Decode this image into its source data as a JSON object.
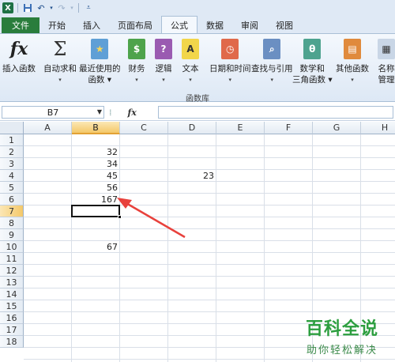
{
  "quick_access": {
    "icons": [
      "excel-icon",
      "save-icon",
      "undo-icon",
      "redo-icon",
      "customize-icon"
    ]
  },
  "tabs": [
    {
      "label": "文件",
      "kind": "file"
    },
    {
      "label": "开始"
    },
    {
      "label": "插入"
    },
    {
      "label": "页面布局"
    },
    {
      "label": "公式",
      "active": true
    },
    {
      "label": "数据"
    },
    {
      "label": "审阅"
    },
    {
      "label": "视图"
    }
  ],
  "ribbon": {
    "group_label": "函数库",
    "buttons": [
      {
        "line1": "插入函数",
        "line2": "",
        "icon": "insert-function-icon"
      },
      {
        "line1": "自动求和",
        "line2": "▾",
        "icon": "autosum-icon"
      },
      {
        "line1": "最近使用的",
        "line2": "函数 ▾",
        "icon": "recent-functions-icon"
      },
      {
        "line1": "财务",
        "line2": "▾",
        "icon": "financial-icon"
      },
      {
        "line1": "逻辑",
        "line2": "▾",
        "icon": "logical-icon"
      },
      {
        "line1": "文本",
        "line2": "▾",
        "icon": "text-icon"
      },
      {
        "line1": "日期和时间",
        "line2": "▾",
        "icon": "date-time-icon"
      },
      {
        "line1": "查找与引用",
        "line2": "▾",
        "icon": "lookup-reference-icon"
      },
      {
        "line1": "数学和",
        "line2": "三角函数 ▾",
        "icon": "math-trig-icon"
      },
      {
        "line1": "其他函数",
        "line2": "▾",
        "icon": "more-functions-icon"
      },
      {
        "line1": "名称",
        "line2": "管理",
        "icon": "name-manager-icon"
      }
    ]
  },
  "formula_bar": {
    "name_box": "B7",
    "fx_label": "fx",
    "formula": ""
  },
  "columns": [
    "A",
    "B",
    "C",
    "D",
    "E",
    "F",
    "G",
    "H"
  ],
  "selected_column": "B",
  "rows": [
    "1",
    "2",
    "3",
    "4",
    "5",
    "6",
    "7",
    "8",
    "9",
    "10",
    "11",
    "12",
    "13",
    "14",
    "15",
    "16",
    "17",
    "18"
  ],
  "selected_row": "7",
  "cells": [
    {
      "ref": "B2",
      "value": "32"
    },
    {
      "ref": "B3",
      "value": "34"
    },
    {
      "ref": "B4",
      "value": "45"
    },
    {
      "ref": "D4",
      "value": "23"
    },
    {
      "ref": "B5",
      "value": "56"
    },
    {
      "ref": "B6",
      "value": "167"
    },
    {
      "ref": "B10",
      "value": "67"
    }
  ],
  "annotation_color": "#e8413c",
  "watermark": {
    "title": "百科全说",
    "subtitle": "助你轻松解决"
  }
}
